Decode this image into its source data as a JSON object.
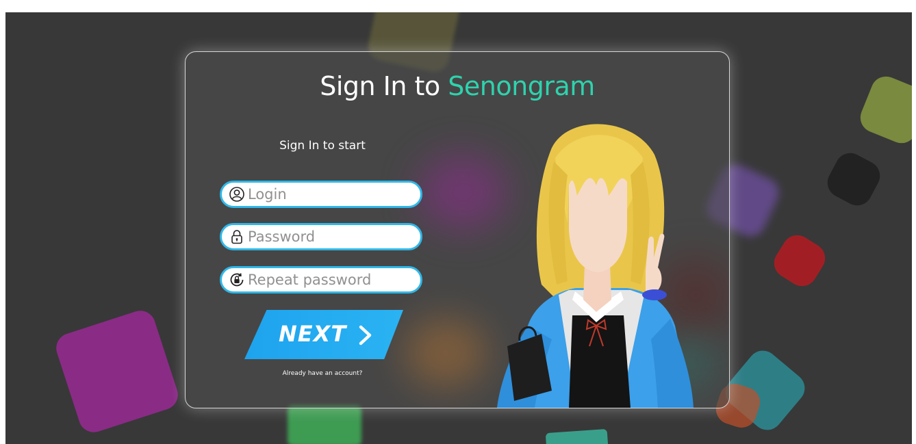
{
  "form": {
    "title_prefix": "Sign In to",
    "title_brand": "Senongram",
    "subtitle": "Sign In to start",
    "login_placeholder": "Login",
    "password_placeholder": "Password",
    "repeat_password_placeholder": "Repeat password",
    "next_label": "NEXT",
    "account_link": "Already have an account?"
  },
  "icons": {
    "login": "user-circle-icon",
    "password": "lock-icon",
    "repeat_password": "unlock-refresh-icon",
    "next": "chevron-right-icon"
  },
  "colors": {
    "brand": "#2ed3ad",
    "accent": "#1ea3ee",
    "background": "#383838"
  }
}
